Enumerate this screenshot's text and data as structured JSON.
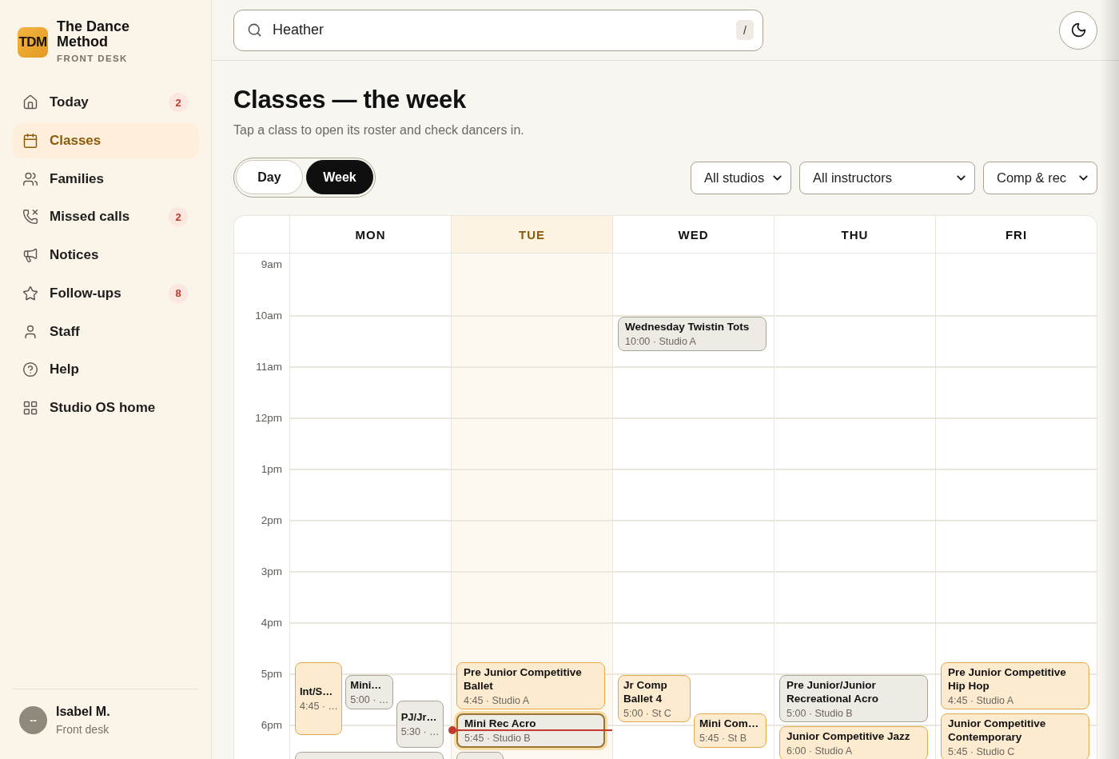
{
  "sidebar": {
    "brand": {
      "logo": "TDM",
      "name": "The Dance Method",
      "subtitle": "FRONT DESK"
    },
    "nav": [
      {
        "label": "Today",
        "selected": false,
        "badge": "2"
      },
      {
        "label": "Classes",
        "selected": true
      },
      {
        "label": "Families",
        "selected": false
      },
      {
        "label": "Missed calls",
        "selected": false,
        "badge": "2"
      },
      {
        "label": "Notices",
        "selected": false
      },
      {
        "label": "Follow-ups",
        "selected": false,
        "badge": "8"
      },
      {
        "label": "Staff",
        "selected": false
      },
      {
        "label": "Help",
        "selected": false
      },
      {
        "label": "Studio OS home",
        "selected": false
      }
    ],
    "user": {
      "initials": "--",
      "name": "Isabel M.",
      "role": "Front desk"
    }
  },
  "search": {
    "value": "Heather",
    "shortcut": "/"
  },
  "page": {
    "title": "Classes — the week",
    "subtitle": "Tap a class to open its roster and check dancers in."
  },
  "view_toggle": [
    {
      "label": "Day",
      "selected": false
    },
    {
      "label": "Week",
      "selected": true
    }
  ],
  "filters": [
    {
      "value": "All studios"
    },
    {
      "value": "All instructors"
    },
    {
      "value": "Comp & rec"
    }
  ],
  "calendar": {
    "hours": [
      "9am",
      "10am",
      "11am",
      "12pm",
      "1pm",
      "2pm",
      "3pm",
      "4pm",
      "5pm",
      "6pm"
    ],
    "days": [
      {
        "label": "MON",
        "today": false,
        "events": [
          {
            "title": "Int/S…",
            "detail": "4:45 · …",
            "kind": "comp",
            "in_progress": false
          },
          {
            "title": "Mini…",
            "detail": "5:00 · …",
            "kind": "rec",
            "in_progress": false
          },
          {
            "title": "PJ/Jr…",
            "detail": "5:30 · …",
            "kind": "rec",
            "in_progress": false
          },
          {
            "kind": "rec",
            "in_progress": false
          }
        ]
      },
      {
        "label": "TUE",
        "today": true,
        "events": [
          {
            "title": "Pre Junior Competitive Ballet",
            "detail": "4:45 · Studio A",
            "kind": "comp",
            "in_progress": false
          },
          {
            "title": "Mini Rec Acro",
            "detail": "5:45 · Studio B",
            "kind": "rec",
            "in_progress": true
          },
          {
            "kind": "rec",
            "in_progress": false
          }
        ]
      },
      {
        "label": "WED",
        "today": false,
        "events": [
          {
            "title": "Wednesday Twistin Tots",
            "detail": "10:00 · Studio A",
            "kind": "rec",
            "in_progress": false
          },
          {
            "title": "Jr Comp Ballet 4",
            "detail": "5:00 · St C",
            "kind": "comp",
            "in_progress": false
          },
          {
            "title": "Mini Com…",
            "detail": "5:45 · St B",
            "kind": "comp",
            "in_progress": false
          }
        ]
      },
      {
        "label": "THU",
        "today": false,
        "events": [
          {
            "title": "Pre Junior/Junior Recreational Acro",
            "detail": "5:00 · Studio B",
            "kind": "rec",
            "in_progress": false
          },
          {
            "title": "Junior Competitive Jazz",
            "detail": "6:00 · Studio A",
            "kind": "comp",
            "in_progress": false
          }
        ]
      },
      {
        "label": "FRI",
        "today": false,
        "events": [
          {
            "title": "Pre Junior Competitive Hip Hop",
            "detail": "4:45 · Studio A",
            "kind": "comp",
            "in_progress": false
          },
          {
            "title": "Junior Competitive Contemporary",
            "detail": "5:45 · Studio C",
            "kind": "comp",
            "in_progress": false
          }
        ]
      }
    ]
  }
}
